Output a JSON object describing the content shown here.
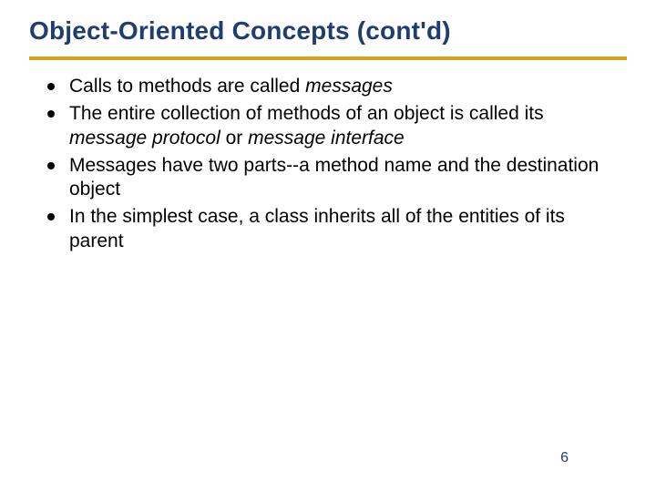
{
  "slide": {
    "title": "Object-Oriented Concepts (cont'd)",
    "page_number": "6",
    "bullets": [
      {
        "pre": "Calls to methods are called ",
        "em1": "messages",
        "mid": "",
        "em2": "",
        "post": ""
      },
      {
        "pre": "The entire collection of methods of an object is called its ",
        "em1": "message protocol",
        "mid": " or ",
        "em2": "message interface",
        "post": ""
      },
      {
        "pre": "Messages have two parts--a method name and the destination object",
        "em1": "",
        "mid": "",
        "em2": "",
        "post": ""
      },
      {
        "pre": "In the simplest case, a class inherits all of the entities of its parent",
        "em1": "",
        "mid": "",
        "em2": "",
        "post": ""
      }
    ]
  }
}
